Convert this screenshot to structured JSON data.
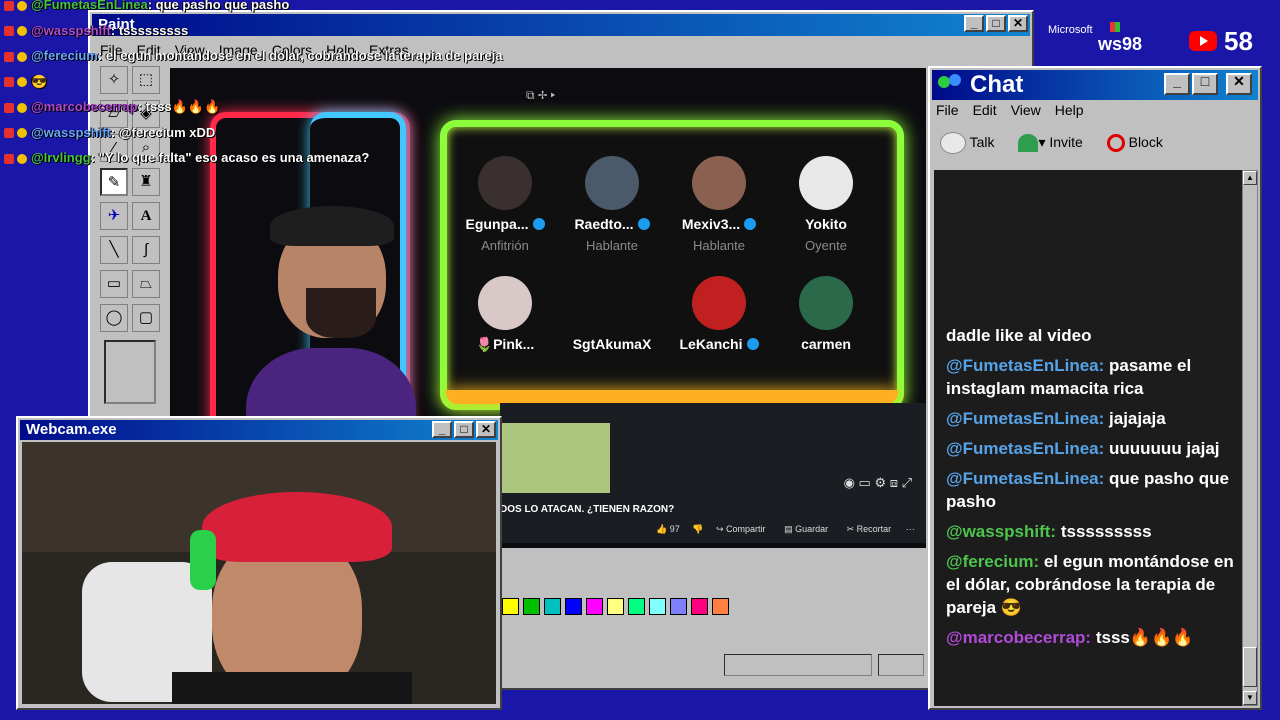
{
  "overlay_chat": [
    {
      "user": "@FumetasEnLinea",
      "text": ": que pasho que pasho"
    },
    {
      "user": "@wasspshift",
      "text": ": tsssssssss"
    },
    {
      "user": "@ferecium",
      "text": ": el egun montándose en el dólar, cobrándose la terapia de pareja"
    },
    {
      "user": "",
      "text": "😎"
    },
    {
      "user": "@marcobecerrap",
      "text": ": tsss🔥🔥🔥"
    },
    {
      "user": "@wasspshift",
      "text": ": @ferecium xDD"
    },
    {
      "user": "@Irvlingg",
      "text": ": \"Y lo que falta\" eso acaso es una amenaza?"
    }
  ],
  "paint": {
    "title": "Paint",
    "menu": [
      "File",
      "Edit",
      "View",
      "Image",
      "Colors",
      "Help",
      "Extras"
    ],
    "palette": [
      "#ffff00",
      "#00c000",
      "#00c0c0",
      "#0000ff",
      "#ff00ff",
      "#ffff80",
      "#00ff80",
      "#80ffff",
      "#8080ff",
      "#ff0080",
      "#ff8040"
    ]
  },
  "stream": {
    "speakers": [
      {
        "name": "Egunpa...",
        "role": "Anfitrión",
        "verified": true,
        "avatar": "#3a3030"
      },
      {
        "name": "Raedto...",
        "role": "Hablante",
        "verified": true,
        "avatar": "#4a5a6a"
      },
      {
        "name": "Mexiv3...",
        "role": "Hablante",
        "verified": true,
        "avatar": "#8a6050"
      },
      {
        "name": "Yokito",
        "role": "Oyente",
        "verified": false,
        "avatar": "#e8e8e8"
      },
      {
        "name": "🌷Pink...",
        "role": "",
        "verified": false,
        "avatar": "#d8c8c8"
      },
      {
        "name": "SgtAkumaX",
        "role": "",
        "verified": false,
        "avatar": "#111111"
      },
      {
        "name": "LeKanchi",
        "role": "",
        "verified": true,
        "avatar": "#c02020"
      },
      {
        "name": "carmen",
        "role": "",
        "verified": false,
        "avatar": "#2a6a4a"
      }
    ],
    "video_title": "DOS LO ATACAN. ¿TIENEN RAZON?",
    "likes": "97",
    "share": "Compartir",
    "save": "Guardar",
    "clip": "Recortar",
    "more": "···"
  },
  "win98_logo": {
    "brand": "Microsoft",
    "product": "ws98"
  },
  "subscriber_count": "58",
  "webcam": {
    "title": "Webcam.exe"
  },
  "chat": {
    "title": "Chat",
    "menu": [
      "File",
      "Edit",
      "View",
      "Help"
    ],
    "toolbar": {
      "talk": "Talk",
      "invite": "Invite",
      "block": "Block"
    },
    "messages": [
      {
        "user": "",
        "text": "dadle like al video"
      },
      {
        "user": "@FumetasEnLinea:",
        "text": "pasame el instaglam mamacita rica"
      },
      {
        "user": "@FumetasEnLinea:",
        "text": "jajajaja"
      },
      {
        "user": "@FumetasEnLinea:",
        "text": "uuuuuuu jajaj"
      },
      {
        "user": "@FumetasEnLinea:",
        "text": "que pasho que pasho"
      },
      {
        "user": "@wasspshift:",
        "text": "tsssssssss"
      },
      {
        "user": "@ferecium:",
        "text": "el egun montándose en el dólar, cobrándose la terapia de pareja 😎"
      },
      {
        "user": "@marcobecerrap:",
        "text": "tsss🔥🔥🔥"
      }
    ]
  }
}
